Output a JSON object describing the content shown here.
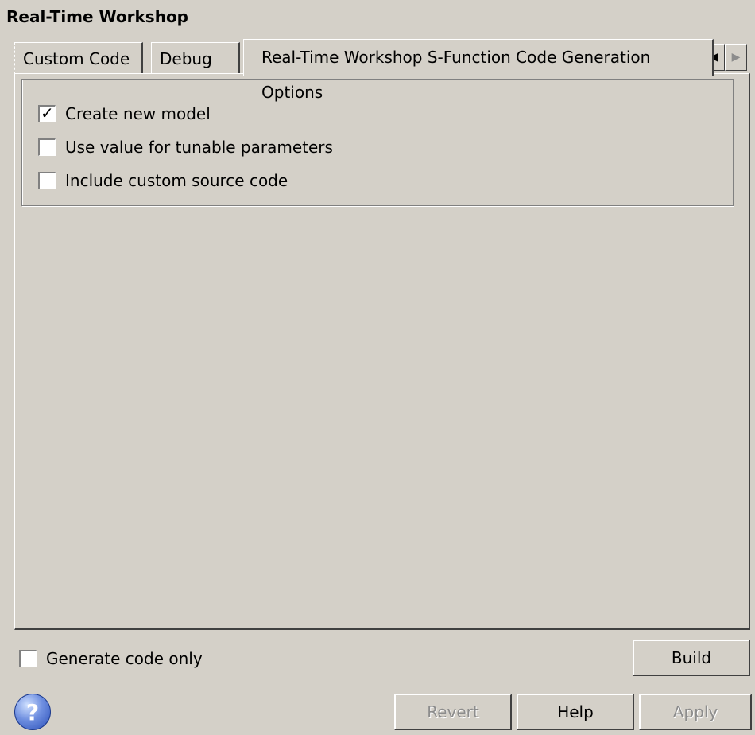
{
  "header": {
    "title": "Real-Time Workshop"
  },
  "tabs": [
    {
      "label": "Custom Code"
    },
    {
      "label": "Debug"
    },
    {
      "label": "Real-Time Workshop S-Function Code Generation Options"
    }
  ],
  "tab_scroll": {
    "left_icon": "arrow-left-icon",
    "right_icon": "arrow-right-icon"
  },
  "options": [
    {
      "label": "Create new model",
      "checked": true
    },
    {
      "label": "Use value for tunable parameters",
      "checked": false
    },
    {
      "label": "Include custom source code",
      "checked": false
    }
  ],
  "bottom": {
    "generate_code_only": {
      "label": "Generate code only",
      "checked": false
    },
    "build_label": "Build",
    "revert_label": "Revert",
    "help_label": "Help",
    "apply_label": "Apply",
    "help_icon": "help-icon"
  }
}
